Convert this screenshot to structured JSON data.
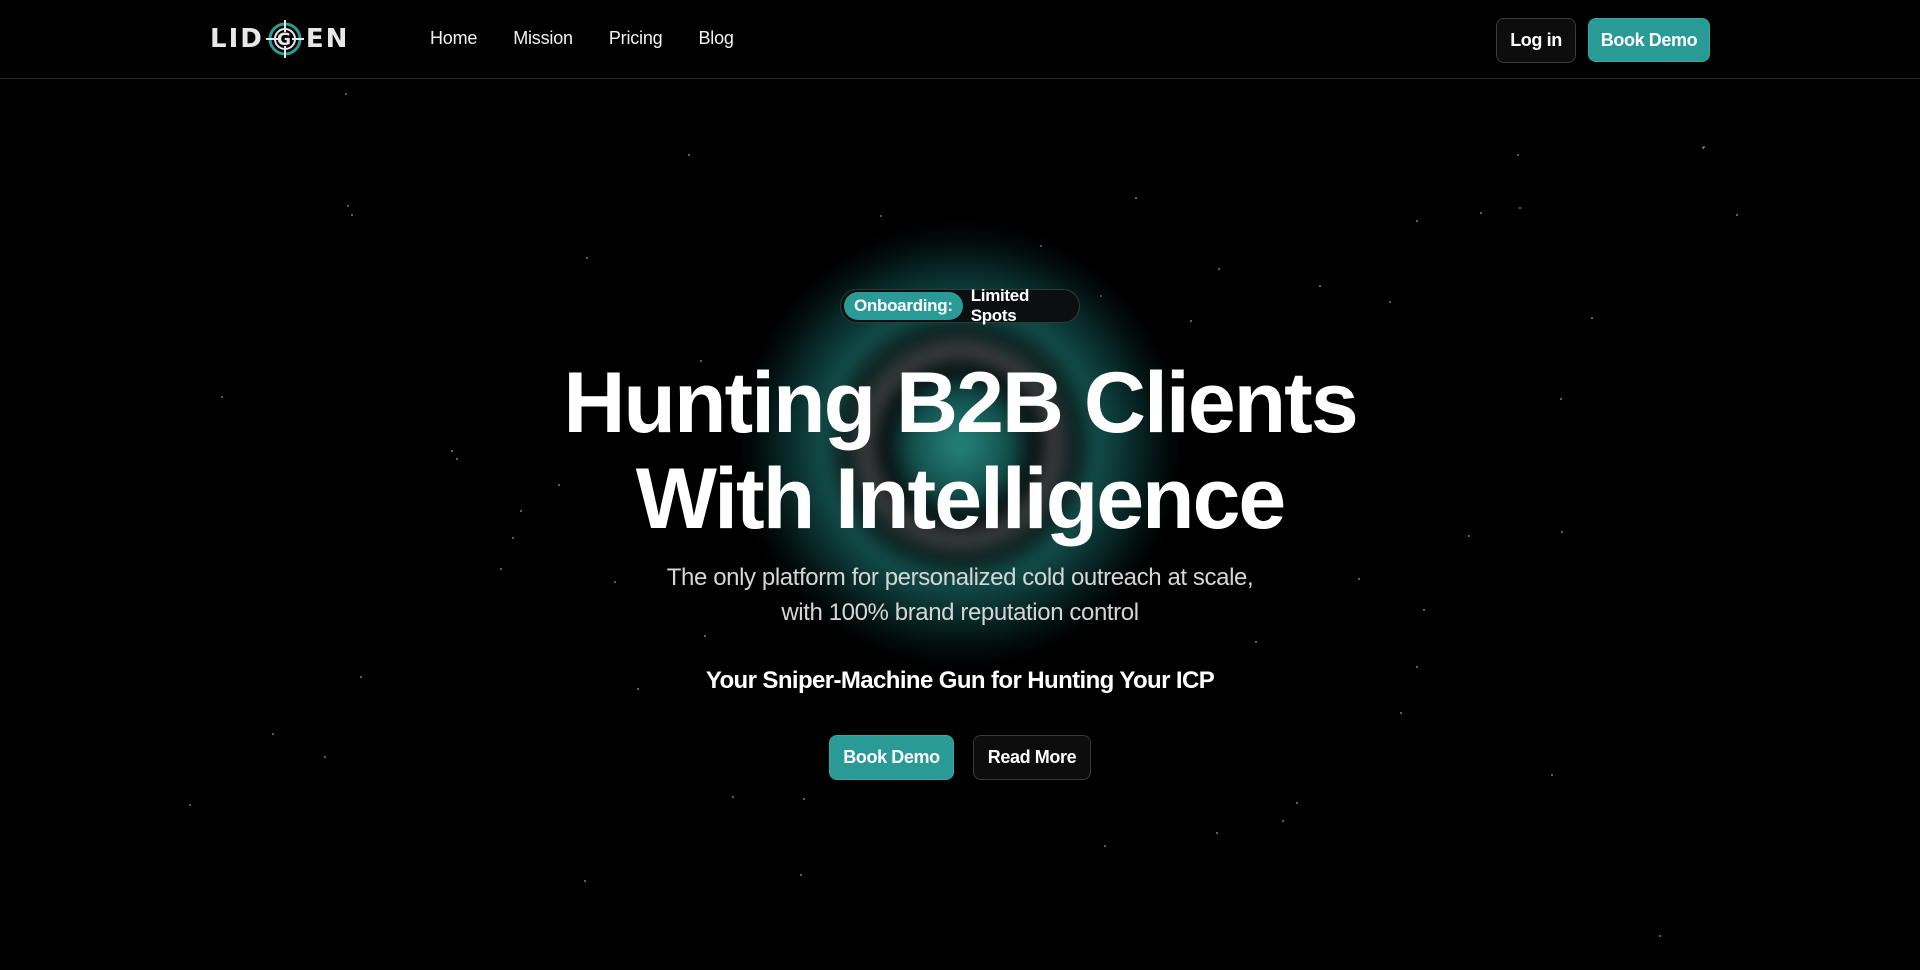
{
  "header": {
    "logo_text_left": "LID",
    "logo_text_right": "EN",
    "logo_alt": "LIDGEN",
    "nav": [
      {
        "label": "Home"
      },
      {
        "label": "Mission"
      },
      {
        "label": "Pricing"
      },
      {
        "label": "Blog"
      }
    ],
    "login_label": "Log in",
    "book_demo_label": "Book Demo"
  },
  "hero": {
    "badge_highlight": "Onboarding:",
    "badge_text": "Limited Spots",
    "title_line1": "Hunting B2B Clients",
    "title_line2": "With Intelligence",
    "subtitle_line1": "The only platform for personalized cold outreach at scale,",
    "subtitle_line2": "with 100% brand reputation control",
    "tagline": "Your Sniper-Machine Gun for Hunting Your ICP",
    "book_demo_label": "Book Demo",
    "read_more_label": "Read More"
  },
  "colors": {
    "background": "#000000",
    "accent": "#2a9a96",
    "text": "#ffffff",
    "muted_text": "#d6d6d6"
  },
  "icons": {
    "logo_mark": "crosshair-scope-icon"
  }
}
